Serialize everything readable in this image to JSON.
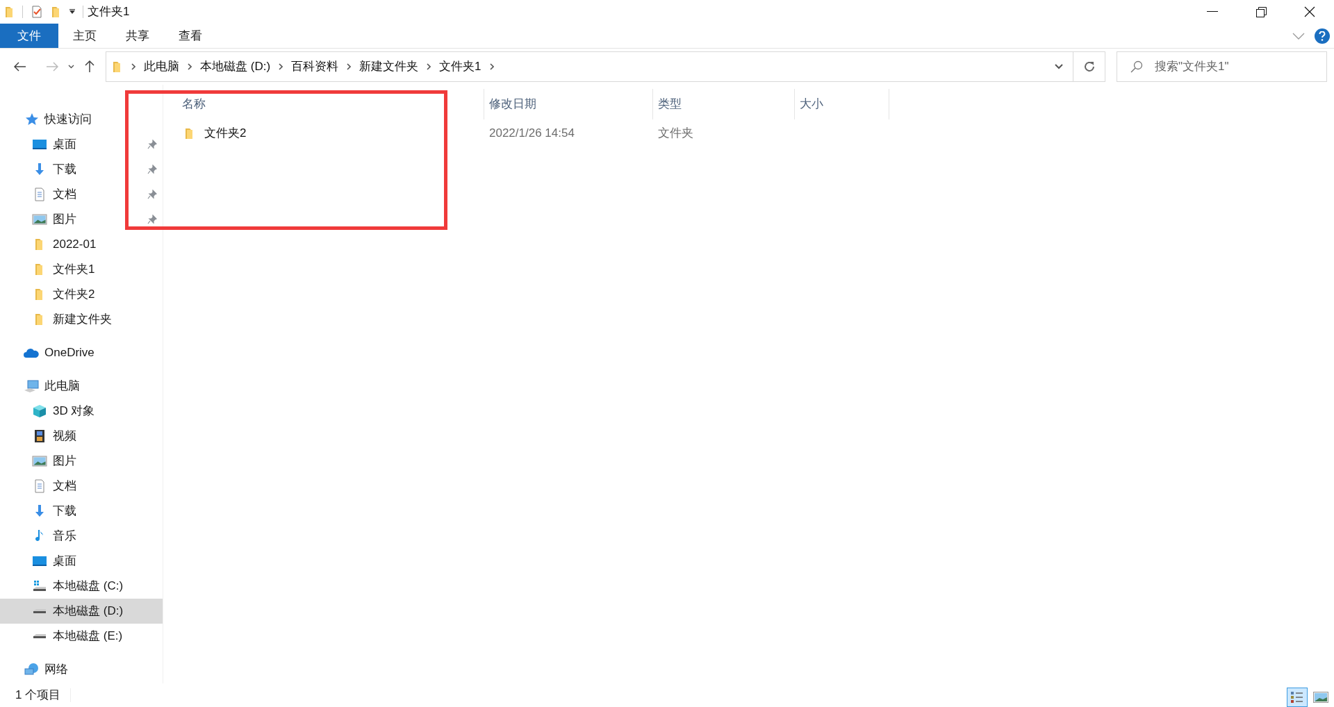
{
  "window": {
    "title": "文件夹1"
  },
  "ribbon": {
    "tabs": [
      {
        "label": "文件",
        "selected": true
      },
      {
        "label": "主页",
        "selected": false
      },
      {
        "label": "共享",
        "selected": false
      },
      {
        "label": "查看",
        "selected": false
      }
    ]
  },
  "address": {
    "crumbs": [
      "此电脑",
      "本地磁盘 (D:)",
      "百科资料",
      "新建文件夹",
      "文件夹1"
    ]
  },
  "search": {
    "placeholder": "搜索\"文件夹1\""
  },
  "sidebar": {
    "items": [
      {
        "label": "快速访问",
        "kind": "star",
        "selected": false,
        "children": [
          {
            "label": "桌面",
            "kind": "desktop",
            "selected": false,
            "pinned": true
          },
          {
            "label": "下载",
            "kind": "download",
            "selected": false,
            "pinned": true
          },
          {
            "label": "文档",
            "kind": "document",
            "selected": false,
            "pinned": true
          },
          {
            "label": "图片",
            "kind": "pictures",
            "selected": false,
            "pinned": true
          },
          {
            "label": "2022-01",
            "kind": "folder",
            "selected": false,
            "pinned": false
          },
          {
            "label": "文件夹1",
            "kind": "folder",
            "selected": false,
            "pinned": false
          },
          {
            "label": "文件夹2",
            "kind": "folder",
            "selected": false,
            "pinned": false
          },
          {
            "label": "新建文件夹",
            "kind": "folder",
            "selected": false,
            "pinned": false
          }
        ]
      },
      {
        "label": "OneDrive",
        "kind": "cloud",
        "selected": false
      },
      {
        "label": "此电脑",
        "kind": "pc",
        "selected": false,
        "children": [
          {
            "label": "3D 对象",
            "kind": "cube",
            "selected": false
          },
          {
            "label": "视频",
            "kind": "video",
            "selected": false
          },
          {
            "label": "图片",
            "kind": "pictures",
            "selected": false
          },
          {
            "label": "文档",
            "kind": "document",
            "selected": false
          },
          {
            "label": "下载",
            "kind": "download",
            "selected": false
          },
          {
            "label": "音乐",
            "kind": "music",
            "selected": false
          },
          {
            "label": "桌面",
            "kind": "desktop",
            "selected": false
          },
          {
            "label": "本地磁盘 (C:)",
            "kind": "system-drive",
            "selected": false
          },
          {
            "label": "本地磁盘 (D:)",
            "kind": "drive",
            "selected": true
          },
          {
            "label": "本地磁盘 (E:)",
            "kind": "drive",
            "selected": false
          }
        ]
      },
      {
        "label": "网络",
        "kind": "network",
        "selected": false
      }
    ]
  },
  "table": {
    "columns": [
      "名称",
      "修改日期",
      "类型",
      "大小"
    ],
    "rows": [
      {
        "name": "文件夹2",
        "date": "2022/1/26 14:54",
        "type": "文件夹",
        "selected": false
      }
    ]
  },
  "status_bar": {
    "text": "1 个项目"
  },
  "view_buttons": [
    {
      "kind": "details",
      "selected": true
    },
    {
      "kind": "thumbnails",
      "selected": false
    }
  ]
}
